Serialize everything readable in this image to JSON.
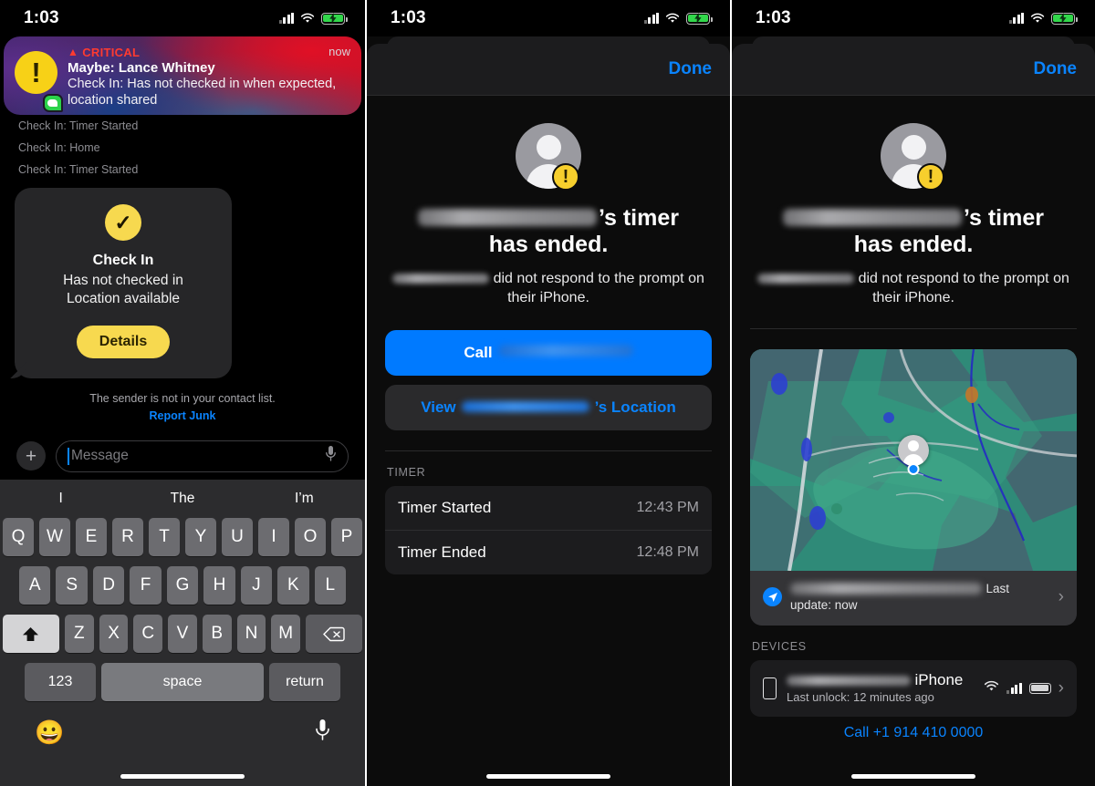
{
  "status_bar": {
    "time": "1:03",
    "icons": [
      "cellular-signal",
      "wifi",
      "battery-charging"
    ]
  },
  "left_panel": {
    "notification": {
      "priority_label": "CRITICAL",
      "timestamp": "now",
      "title": "Maybe: Lance Whitney",
      "body": "Check In: Has not checked in when expected, location shared",
      "icon": "alert-exclamation-icon",
      "app_badge": "messages-badge-icon"
    },
    "system_lines": [
      "Check In: Timer Started",
      "Check In: Home",
      "Check In: Timer Started"
    ],
    "bubble": {
      "badge_icon": "checkmark-icon",
      "title": "Check In",
      "line1": "Has not checked in",
      "line2": "Location available",
      "button_label": "Details"
    },
    "junk_note": "The sender is not in your contact list.",
    "junk_link": "Report Junk",
    "input": {
      "placeholder": "Message",
      "plus_label": "+",
      "mic_icon": "microphone-icon"
    },
    "keyboard": {
      "predictions": [
        "I",
        "The",
        "I’m"
      ],
      "row1": [
        "Q",
        "W",
        "E",
        "R",
        "T",
        "Y",
        "U",
        "I",
        "O",
        "P"
      ],
      "row2": [
        "A",
        "S",
        "D",
        "F",
        "G",
        "H",
        "J",
        "K",
        "L"
      ],
      "row3": [
        "Z",
        "X",
        "C",
        "V",
        "B",
        "N",
        "M"
      ],
      "shift_icon": "shift-up-arrow-icon",
      "backspace_icon": "backspace-icon",
      "numeric_label": "123",
      "space_label": "space",
      "return_label": "return",
      "emoji_icon": "emoji-smiley-icon",
      "dictation_icon": "microphone-icon"
    }
  },
  "mid_panel": {
    "done_label": "Done",
    "avatar_icon": "person-avatar-icon",
    "warning_badge": "exclamation-badge-icon",
    "headline_suffix": "’s timer",
    "headline_line2": "has ended.",
    "subtext": "did not respond to the prompt on their iPhone.",
    "call_label": "Call",
    "view_label_prefix": "View",
    "view_label_suffix": "’s Location",
    "timer_section_label": "TIMER",
    "timer_rows": [
      {
        "label": "Timer Started",
        "value": "12:43 PM"
      },
      {
        "label": "Timer Ended",
        "value": "12:48 PM"
      }
    ]
  },
  "right_panel": {
    "done_label": "Done",
    "avatar_icon": "person-avatar-icon",
    "warning_badge": "exclamation-badge-icon",
    "headline_suffix": "’s timer",
    "headline_line2": "has ended.",
    "subtext": "did not respond to the prompt on their iPhone.",
    "map": {
      "location_icon": "location-arrow-icon",
      "last_update": "Last update: now",
      "pin_icon": "person-map-pin-icon",
      "chevron": "›"
    },
    "devices_section_label": "DEVICES",
    "device": {
      "icon": "iphone-device-icon",
      "name": "iPhone",
      "sub": "Last unlock: 12 minutes ago",
      "wifi_icon": "wifi-icon",
      "signal_icon": "cellular-signal-icon",
      "battery_icon": "battery-icon",
      "chevron": "›"
    },
    "call_number_partial": "Call +1 914 410 0000"
  },
  "colors": {
    "accent_blue": "#0a84ff",
    "critical_red": "#ff3b30",
    "warn_yellow": "#f7d94f",
    "battery_green": "#32d74b"
  }
}
